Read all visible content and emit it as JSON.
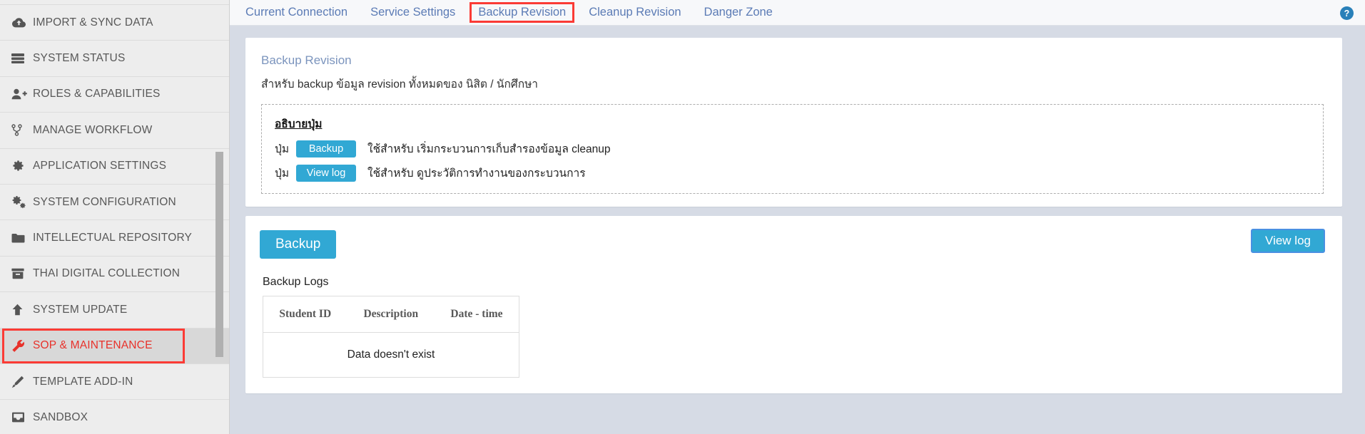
{
  "sidebar": {
    "items": [
      {
        "label": "IMPORT & SYNC DATA",
        "icon": "cloud-upload-icon",
        "active": false
      },
      {
        "label": "SYSTEM STATUS",
        "icon": "server-icon",
        "active": false
      },
      {
        "label": "ROLES & CAPABILITIES",
        "icon": "user-plus-icon",
        "active": false
      },
      {
        "label": "MANAGE WORKFLOW",
        "icon": "branch-icon",
        "active": false
      },
      {
        "label": "APPLICATION SETTINGS",
        "icon": "gear-icon",
        "active": false
      },
      {
        "label": "SYSTEM CONFIGURATION",
        "icon": "gears-icon",
        "active": false
      },
      {
        "label": "INTELLECTUAL REPOSITORY",
        "icon": "folder-icon",
        "active": false
      },
      {
        "label": "THAI DIGITAL COLLECTION",
        "icon": "archive-icon",
        "active": false
      },
      {
        "label": "SYSTEM UPDATE",
        "icon": "arrow-up-icon",
        "active": false
      },
      {
        "label": "SOP & MAINTENANCE",
        "icon": "wrench-icon",
        "active": true
      },
      {
        "label": "TEMPLATE ADD-IN",
        "icon": "pencil-icon",
        "active": false
      },
      {
        "label": "SANDBOX",
        "icon": "inbox-icon",
        "active": false
      }
    ],
    "active_highlight_color": "#fb3b35",
    "active_text_color": "#e8312a"
  },
  "tabs": [
    {
      "label": "Current Connection",
      "selected": false
    },
    {
      "label": "Service Settings",
      "selected": false
    },
    {
      "label": "Backup Revision",
      "selected": true
    },
    {
      "label": "Cleanup Revision",
      "selected": false
    },
    {
      "label": "Danger Zone",
      "selected": false
    }
  ],
  "help": {
    "icon": "question-circle-icon",
    "color": "#2980b9"
  },
  "panel": {
    "title": "Backup Revision",
    "description": "สำหรับ backup ข้อมูล revision ทั้งหมดของ นิสิต / นักศึกษา",
    "legend": {
      "heading": "อธิบายปุ่ม",
      "rows": [
        {
          "prefix": "ปุ่ม",
          "button": "Backup",
          "text": "ใช้สำหรับ เริ่มกระบวนการเก็บสำรองข้อมูล cleanup"
        },
        {
          "prefix": "ปุ่ม",
          "button": "View log",
          "text": "ใช้สำหรับ ดูประวัติการทำงานของกระบวนการ"
        }
      ]
    }
  },
  "actions": {
    "backup_label": "Backup",
    "view_log_label": "View log",
    "accent_color": "#31a8d4"
  },
  "logs": {
    "title": "Backup Logs",
    "columns": [
      "Student ID",
      "Description",
      "Date - time"
    ],
    "rows": [],
    "empty_message": "Data doesn't exist"
  }
}
